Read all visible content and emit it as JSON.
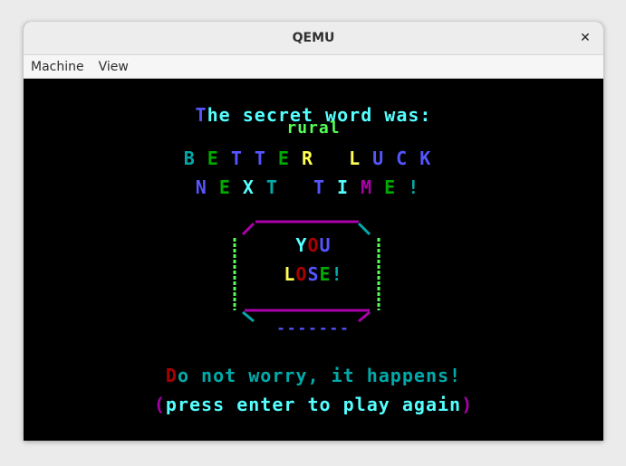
{
  "window": {
    "title": "QEMU"
  },
  "menubar": {
    "items": [
      "Machine",
      "View"
    ]
  },
  "game": {
    "secret_intro": "The secret word was:",
    "secret_word": "rural",
    "better_luck": "BETTER LUCK",
    "next_time": "NEXT TIME!",
    "you": "YOU",
    "lose": "LOSE!",
    "blank": "-------",
    "worry": "Do not worry, it happens!",
    "press_enter": "(press enter to play again)"
  },
  "colors": {
    "background": "#000000",
    "blue": "#5555ff",
    "cyan": "#55ffff",
    "dark_cyan": "#00aaaa",
    "green": "#55ff55",
    "dark_green": "#00aa00",
    "yellow": "#ffff55",
    "red": "#aa0000",
    "magenta": "#aa00aa"
  }
}
